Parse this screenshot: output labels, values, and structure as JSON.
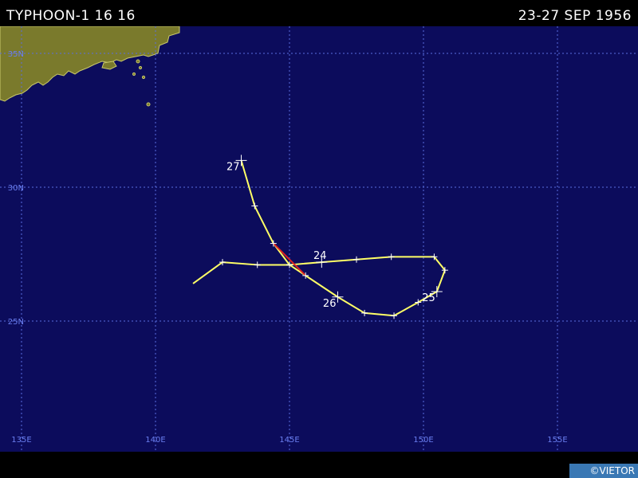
{
  "header": {
    "storm_title": "TYPHOON-1 16 16",
    "date_range": "23-27 SEP 1956"
  },
  "credit": "©VIETOR",
  "map": {
    "colors": {
      "ocean": "#0c0c5c",
      "land": "#7a7a2c",
      "coast": "#c8c86a",
      "grid": "#5a6ee0",
      "grid_label": "#6a7ef0",
      "track": "#ffff66",
      "track_highlight": "#dd2222",
      "marker": "#ffffff"
    },
    "lat_lines": [
      {
        "lat": 35,
        "label": "35N"
      },
      {
        "lat": 30,
        "label": "30N"
      },
      {
        "lat": 25,
        "label": "25N"
      }
    ],
    "lon_lines": [
      {
        "lon": 135,
        "label": "135E"
      },
      {
        "lon": 140,
        "label": "140E"
      },
      {
        "lon": 145,
        "label": "145E"
      },
      {
        "lon": 150,
        "label": "150E"
      },
      {
        "lon": 155,
        "label": "155E"
      }
    ],
    "track": [
      {
        "lon": 141.4,
        "lat": 26.4
      },
      {
        "lon": 142.5,
        "lat": 27.2
      },
      {
        "lon": 143.8,
        "lat": 27.1
      },
      {
        "lon": 145.0,
        "lat": 27.1
      },
      {
        "lon": 146.2,
        "lat": 27.2
      },
      {
        "lon": 147.5,
        "lat": 27.3
      },
      {
        "lon": 148.8,
        "lat": 27.4
      },
      {
        "lon": 150.4,
        "lat": 27.4
      },
      {
        "lon": 150.8,
        "lat": 26.9
      },
      {
        "lon": 150.5,
        "lat": 26.1
      },
      {
        "lon": 149.8,
        "lat": 25.7
      },
      {
        "lon": 148.9,
        "lat": 25.2
      },
      {
        "lon": 147.8,
        "lat": 25.3
      },
      {
        "lon": 146.8,
        "lat": 25.9
      },
      {
        "lon": 145.6,
        "lat": 26.7
      },
      {
        "lon": 145.0,
        "lat": 27.1
      },
      {
        "lon": 144.4,
        "lat": 27.9
      },
      {
        "lon": 143.7,
        "lat": 29.3
      },
      {
        "lon": 143.2,
        "lat": 31.0
      }
    ],
    "highlight_segment": [
      {
        "lon": 144.4,
        "lat": 27.9
      },
      {
        "lon": 145.6,
        "lat": 26.7
      }
    ],
    "day_labels": [
      {
        "text": "24",
        "lon": 146.2,
        "lat": 27.2,
        "anchor": "end"
      },
      {
        "text": "25",
        "lon": 150.5,
        "lat": 26.1,
        "anchor": "end"
      },
      {
        "text": "26",
        "lon": 146.8,
        "lat": 25.9,
        "anchor": "end"
      },
      {
        "text": "27",
        "lon": 143.2,
        "lat": 31.0,
        "anchor": "end"
      }
    ]
  }
}
